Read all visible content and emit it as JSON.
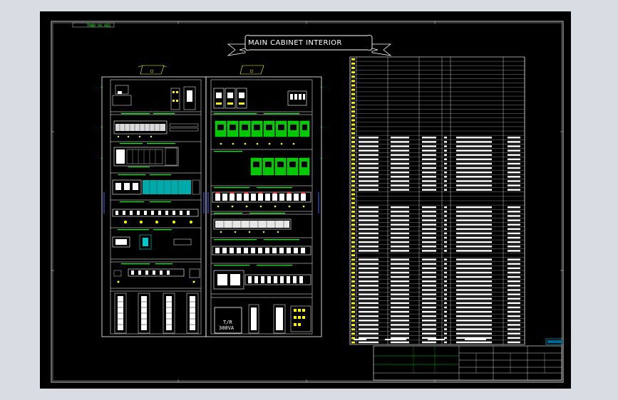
{
  "drawing": {
    "title": "MAIN CABINET INTERIOR",
    "corner_tag": "THWD  94 083",
    "transformer_label": "T/R",
    "transformer_rating": "300VA",
    "colors": {
      "background": "#000000",
      "frame": "#ffffff",
      "green": "#00ff00",
      "yellow": "#ffff00",
      "cyan": "#00ffff",
      "blue": "#4169ff"
    }
  }
}
